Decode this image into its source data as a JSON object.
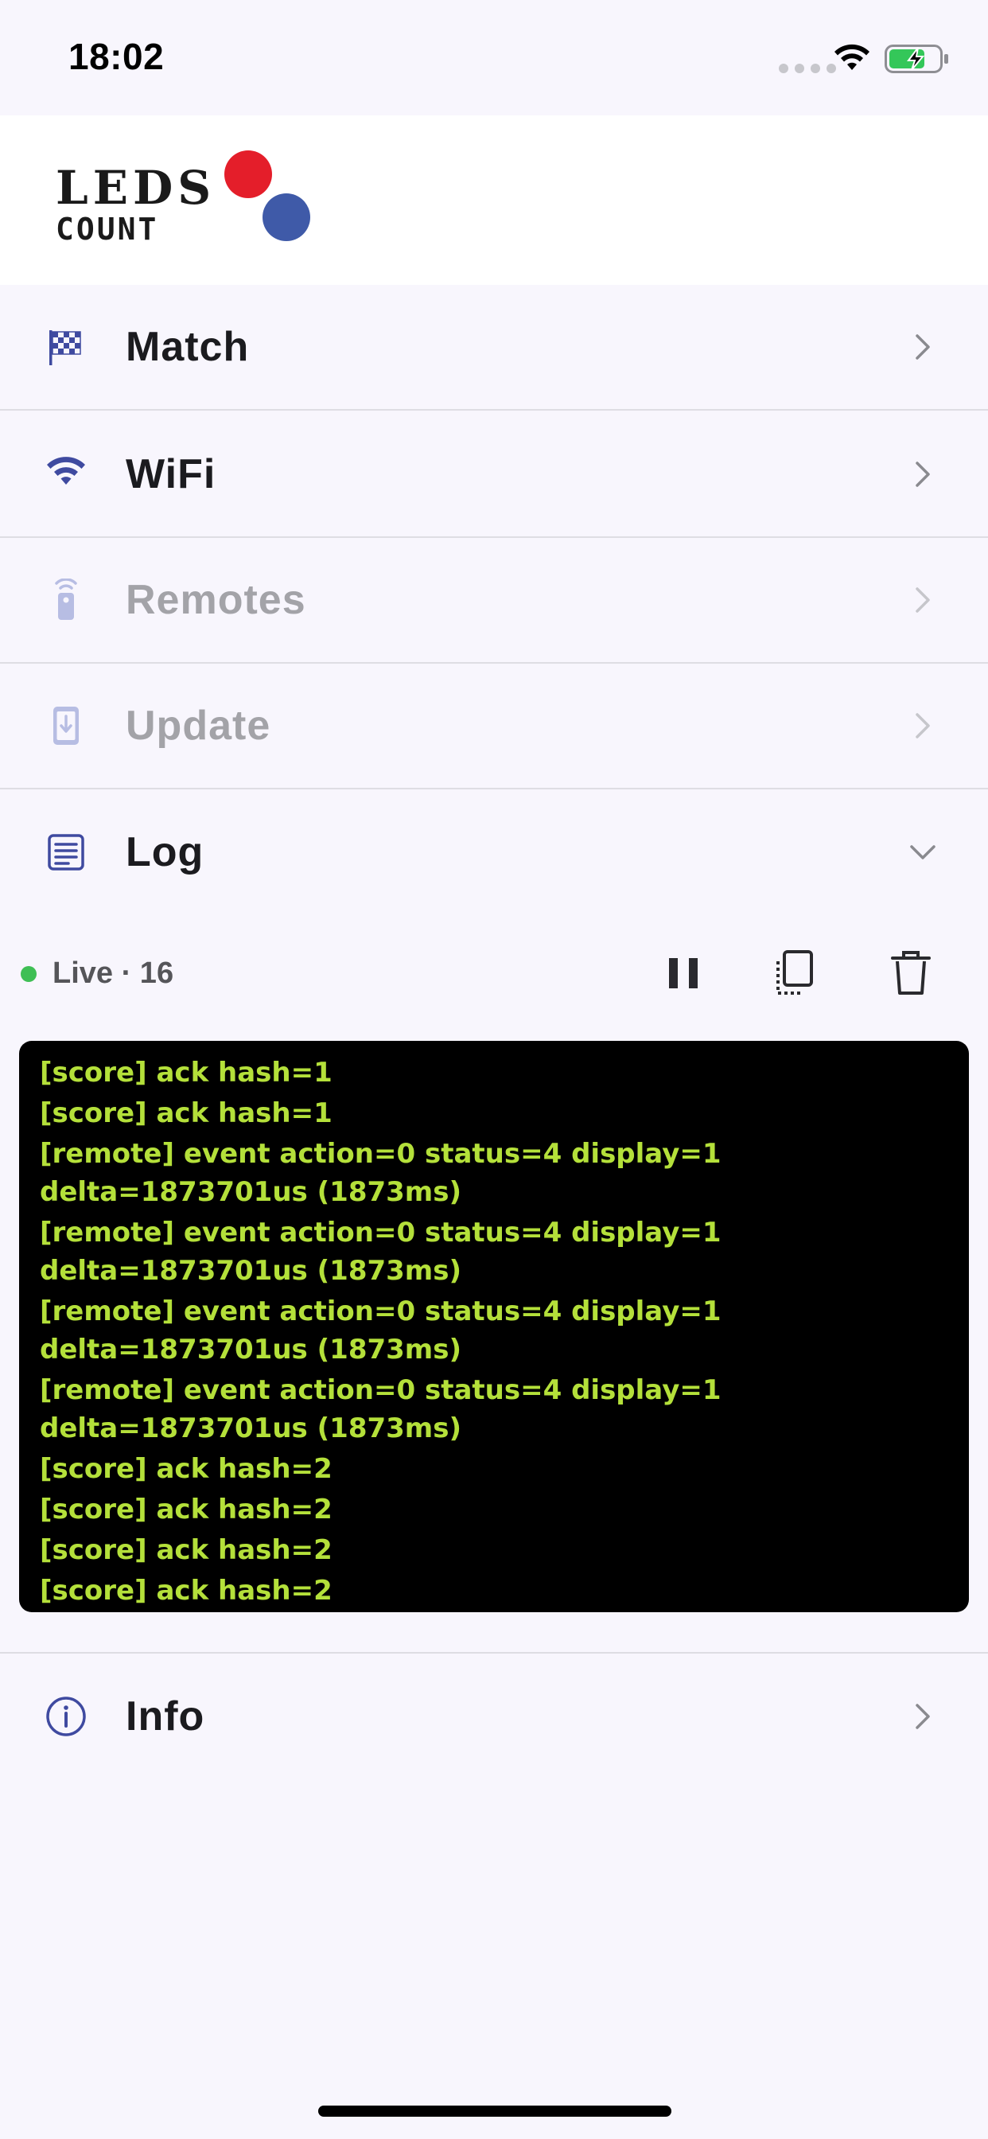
{
  "status_bar": {
    "time": "18:02",
    "icons": [
      "cellular-icon",
      "wifi-icon",
      "battery-charging-icon"
    ]
  },
  "header": {
    "logo_line1": "LEDS",
    "logo_line2": "COUNT",
    "colors": {
      "red": "#e41e2a",
      "blue": "#3f5aa8"
    }
  },
  "menu": [
    {
      "label": "Match",
      "icon": "checkered-flag-icon",
      "enabled": true
    },
    {
      "label": "WiFi",
      "icon": "wifi-icon",
      "enabled": true
    },
    {
      "label": "Remotes",
      "icon": "remote-icon",
      "enabled": false
    },
    {
      "label": "Update",
      "icon": "phone-download-icon",
      "enabled": false
    },
    {
      "label": "Log",
      "icon": "document-lines-icon",
      "enabled": true,
      "expanded": true
    },
    {
      "label": "Info",
      "icon": "info-circle-icon",
      "enabled": true
    }
  ],
  "log": {
    "status_label": "Live · 16",
    "status_color": "#3fbf55",
    "actions": [
      "pause",
      "copy",
      "delete"
    ],
    "lines": [
      "[score] ack hash=1",
      "[score] ack hash=1",
      "[remote] event action=0 status=4 display=1\ndelta=1873701us (1873ms)",
      "[remote] event action=0 status=4 display=1\ndelta=1873701us (1873ms)",
      "[remote] event action=0 status=4 display=1\ndelta=1873701us (1873ms)",
      "[remote] event action=0 status=4 display=1\ndelta=1873701us (1873ms)",
      "[score] ack hash=2",
      "[score] ack hash=2",
      "[score] ack hash=2",
      "[score] ack hash=2"
    ],
    "text_color": "#b4e03a"
  }
}
